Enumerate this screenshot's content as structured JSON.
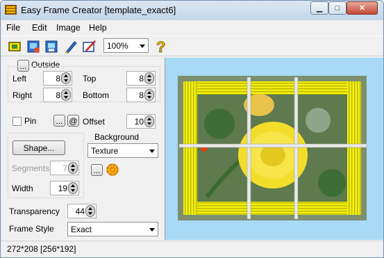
{
  "window": {
    "title": "Easy Frame Creator [template_exact6]"
  },
  "menu": [
    "File",
    "Edit",
    "Image",
    "Help"
  ],
  "toolbar": {
    "zoom": "100%"
  },
  "outside": {
    "button_label": "...",
    "label": "Outside",
    "left_label": "Left",
    "left_value": "8",
    "top_label": "Top",
    "top_value": "8",
    "right_label": "Right",
    "right_value": "8",
    "bottom_label": "Bottom",
    "bottom_value": "8"
  },
  "pin": {
    "label": "Pin",
    "more": "...",
    "at": "@",
    "offset_label": "Offset",
    "offset_value": "10"
  },
  "shape": {
    "button_label": "Shape...",
    "segments_label": "Segments",
    "segments_value": "7",
    "width_label": "Width",
    "width_value": "19"
  },
  "background": {
    "label": "Background",
    "selected": "Texture",
    "more": "..."
  },
  "transparency": {
    "label": "Transparency",
    "value": "44"
  },
  "frame_style": {
    "label": "Frame Style",
    "selected": "Exact"
  },
  "status": {
    "text": "272*208  [256*192]"
  },
  "colors": {
    "frame_yellow": "#f2ee10",
    "preview_bg": "#a9daf5",
    "title_bg": "#cfe0f2"
  }
}
